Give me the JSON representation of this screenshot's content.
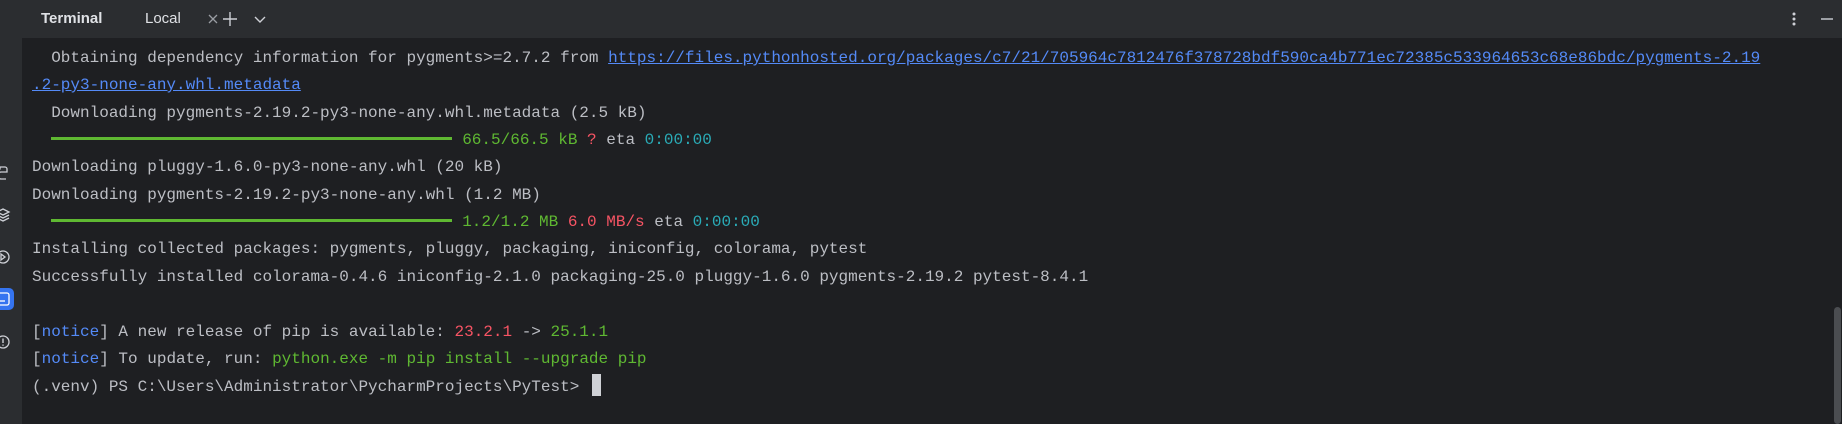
{
  "panel": {
    "title": "Terminal",
    "tab_label": "Local"
  },
  "icons": {
    "left_strip": [
      "python-packages-icon",
      "layers-icon",
      "run-services-icon",
      "terminal-icon",
      "problems-icon"
    ],
    "tab_close": "close-icon",
    "new_tab": "plus-icon",
    "tab_menu": "chevron-down-icon",
    "options": "more-vertical-icon",
    "minimize": "minimize-icon"
  },
  "colors": {
    "background": "#1e1f22",
    "header_bg": "#2b2d30",
    "text": "#bcbec4",
    "link": "#548af7",
    "green": "#5fb832",
    "red": "#f75464",
    "cyan": "#2aacb8",
    "accent": "#3574f0"
  },
  "terminal": {
    "line1_prefix": "  Obtaining dependency information for pygments>=2.7.2 from ",
    "line1_link": "https://files.pythonhosted.org/packages/c7/21/705964c7812476f378728bdf590ca4b771ec72385c533964653c68e86bdc/pygments-2.19",
    "line2_link": ".2-py3-none-any.whl.metadata",
    "line3": "  Downloading pygments-2.19.2-py3-none-any.whl.metadata (2.5 kB)",
    "progress1": {
      "size": "66.5/66.5 kB",
      "speed": "?",
      "eta_label": "eta",
      "eta": "0:00:00"
    },
    "line5": "Downloading pluggy-1.6.0-py3-none-any.whl (20 kB)",
    "line6": "Downloading pygments-2.19.2-py3-none-any.whl (1.2 MB)",
    "progress2": {
      "size": "1.2/1.2 MB",
      "speed": "6.0 MB/s",
      "eta_label": "eta",
      "eta": "0:00:00"
    },
    "line8": "Installing collected packages: pygments, pluggy, packaging, iniconfig, colorama, pytest",
    "line9": "Successfully installed colorama-0.4.6 iniconfig-2.1.0 packaging-25.0 pluggy-1.6.0 pygments-2.19.2 pytest-8.4.1",
    "notice1": {
      "tag": "notice",
      "text": " A new release of pip is available: ",
      "old_version": "23.2.1",
      "arrow": " -> ",
      "new_version": "25.1.1"
    },
    "notice2": {
      "tag": "notice",
      "text": " To update, run: ",
      "command": "python.exe -m pip install --upgrade pip"
    },
    "prompt": "(.venv) PS C:\\Users\\Administrator\\PycharmProjects\\PyTest>"
  }
}
